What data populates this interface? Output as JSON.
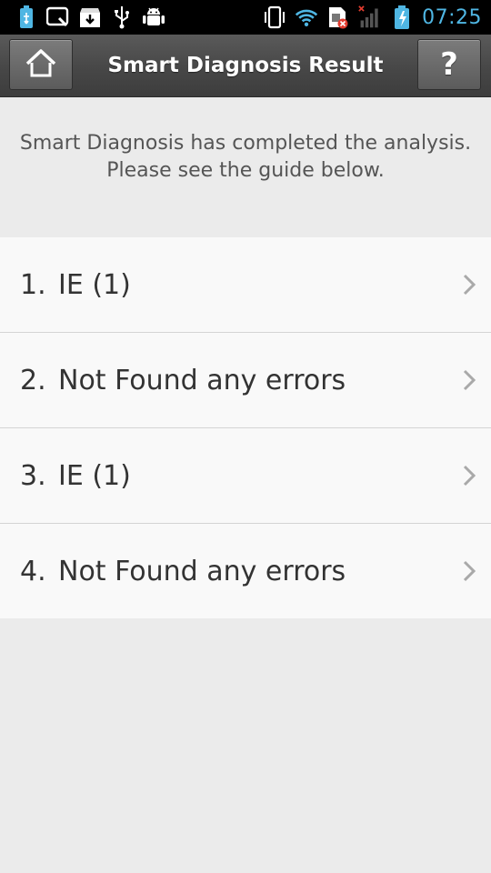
{
  "status_bar": {
    "time": "07:25",
    "time_color": "#4fb6e3",
    "left_icons": [
      "battery-usb-icon",
      "search-notification-icon",
      "download-icon",
      "usb-icon",
      "android-debug-icon"
    ],
    "right_icons": [
      "vibrate-icon",
      "wifi-icon",
      "sim-error-icon",
      "signal-icon",
      "battery-charging-icon"
    ]
  },
  "header": {
    "title": "Smart Diagnosis Result",
    "home_icon": "home-icon",
    "help_label": "?"
  },
  "message": {
    "text": "Smart Diagnosis has completed the analysis. Please see the guide below."
  },
  "results": [
    {
      "number": "1.",
      "label": "IE (1)"
    },
    {
      "number": "2.",
      "label": "Not Found any errors"
    },
    {
      "number": "3.",
      "label": "IE (1)"
    },
    {
      "number": "4.",
      "label": "Not Found any errors"
    }
  ],
  "colors": {
    "background": "#ebebeb",
    "list_background": "#f9f9f9",
    "header": "#474747",
    "text": "#333333"
  }
}
